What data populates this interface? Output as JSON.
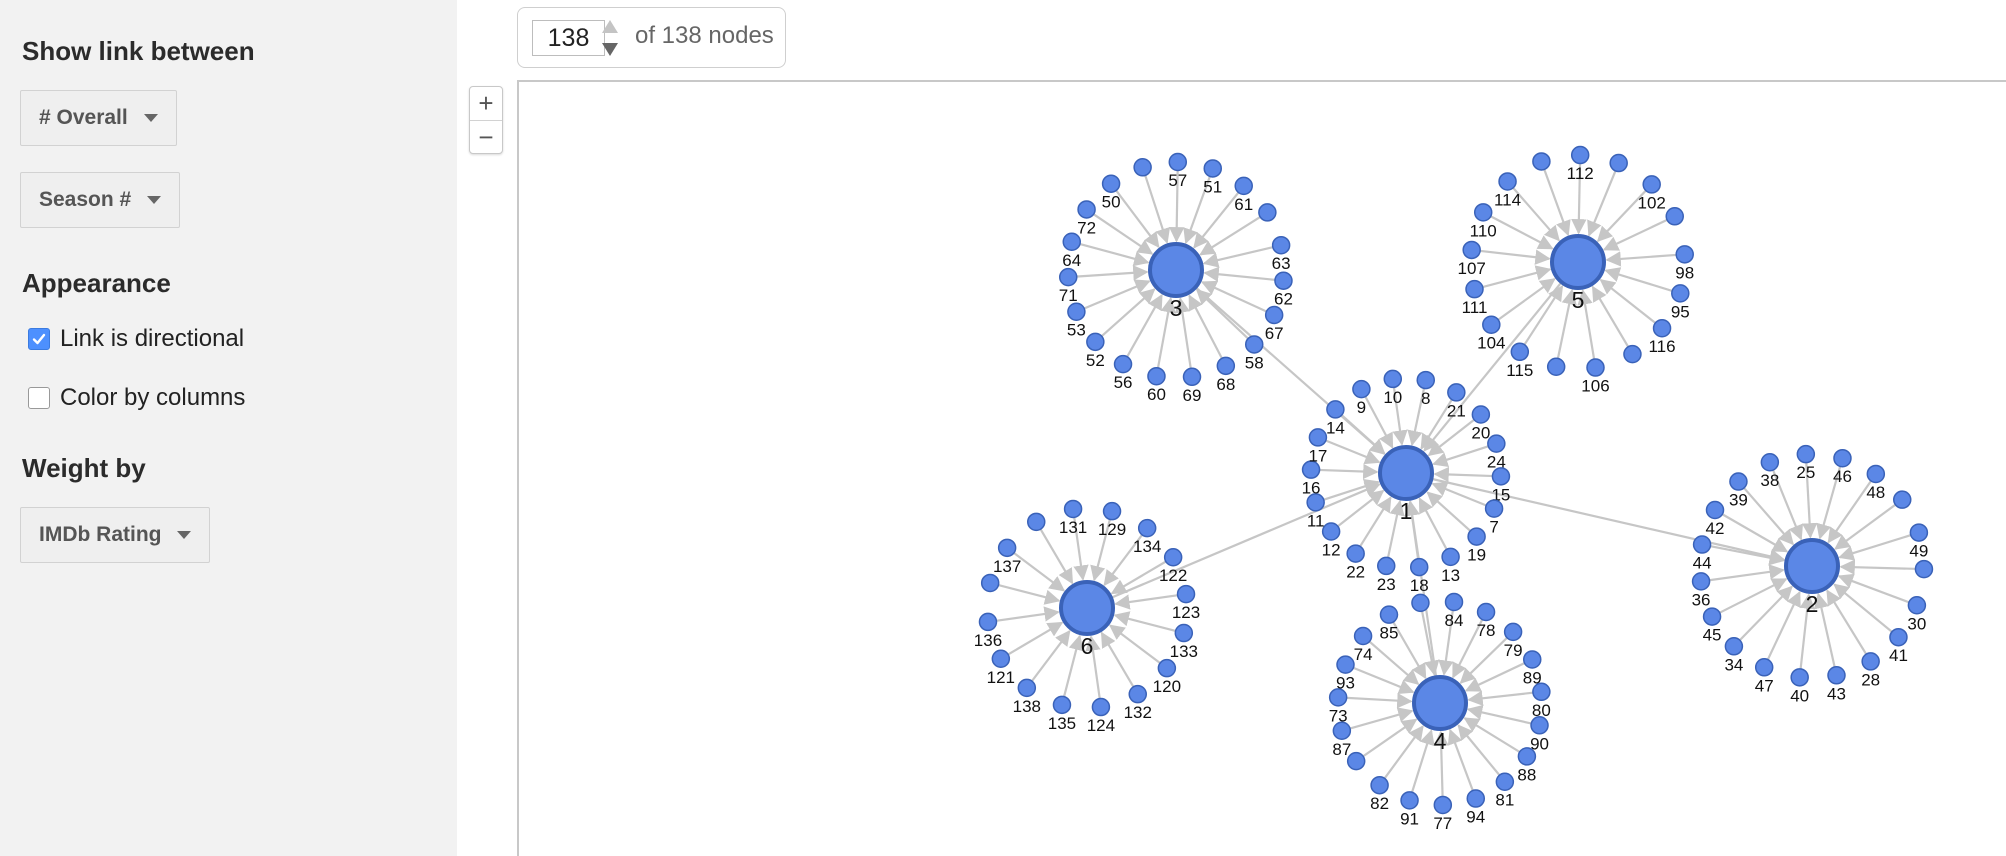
{
  "panel": {
    "link_heading": "Show link between",
    "dropdown_overall": "# Overall",
    "dropdown_season": "Season #",
    "appearance_heading": "Appearance",
    "checkbox_directional": {
      "label": "Link is directional",
      "checked": true
    },
    "checkbox_color": {
      "label": "Color by columns",
      "checked": false
    },
    "weight_heading": "Weight by",
    "dropdown_weight": "IMDb Rating"
  },
  "node_counter": {
    "value": "138",
    "of_text": "of 138 nodes"
  },
  "zoom": {
    "in": "+",
    "out": "−"
  },
  "graph": {
    "node_color": "#5b87e6",
    "node_stroke": "#3a62b8",
    "edge_color": "#c6c6c6",
    "hubs": [
      {
        "label": "1",
        "leaves": [
          "9",
          "10",
          "8",
          "21",
          "20",
          "24",
          "15",
          "7",
          "19",
          "13",
          "18",
          "23",
          "22",
          "12",
          "11",
          "16",
          "17",
          "14"
        ]
      },
      {
        "label": "2",
        "leaves": [
          "42",
          "39",
          "38",
          "25",
          "46",
          "48",
          "",
          "49",
          "",
          "30",
          "41",
          "28",
          "43",
          "40",
          "47",
          "34",
          "45",
          "36",
          "44"
        ]
      },
      {
        "label": "3",
        "leaves": [
          "",
          "57",
          "51",
          "61",
          "",
          "63",
          "62",
          "67",
          "58",
          "68",
          "69",
          "60",
          "56",
          "52",
          "53",
          "71",
          "64",
          "72",
          "50"
        ]
      },
      {
        "label": "4",
        "leaves": [
          "85",
          "",
          "84",
          "78",
          "79",
          "89",
          "80",
          "90",
          "88",
          "81",
          "94",
          "77",
          "91",
          "82",
          "",
          "87",
          "73",
          "93",
          "74"
        ]
      },
      {
        "label": "5",
        "leaves": [
          "",
          "112",
          "",
          "102",
          "",
          "98",
          "95",
          "116",
          "",
          "106",
          "",
          "115",
          "104",
          "111",
          "107",
          "110",
          "114"
        ]
      },
      {
        "label": "6",
        "leaves": [
          "131",
          "129",
          "134",
          "122",
          "123",
          "133",
          "120",
          "132",
          "124",
          "135",
          "138",
          "121",
          "136",
          "",
          "137",
          ""
        ]
      }
    ]
  }
}
